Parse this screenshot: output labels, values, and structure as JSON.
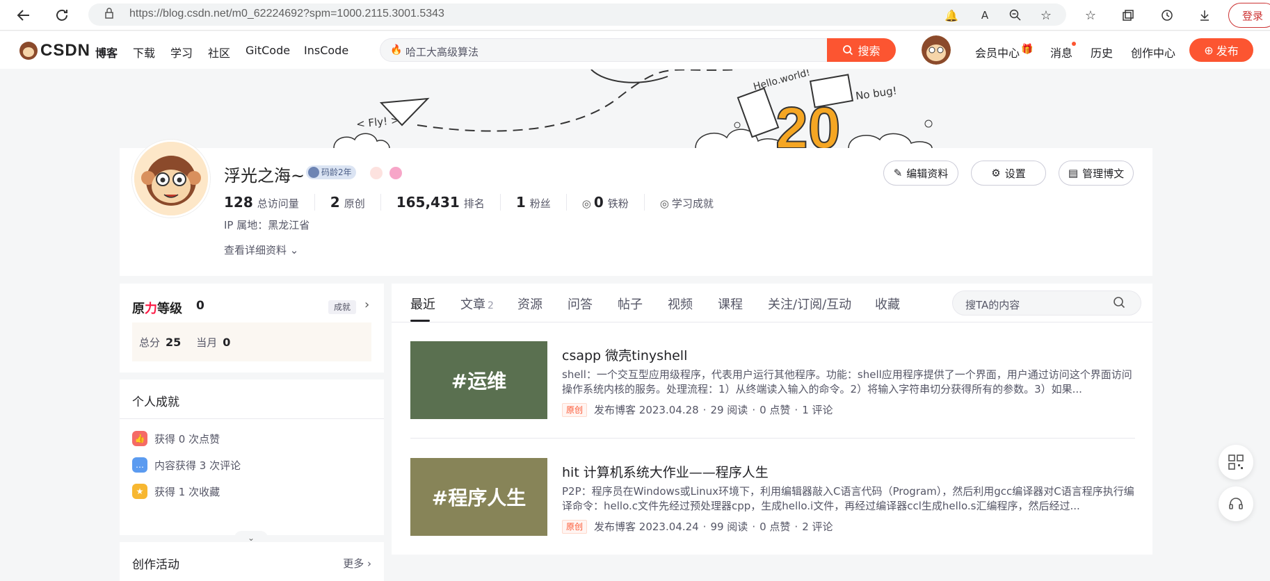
{
  "browser": {
    "url": "https://blog.csdn.net/m0_62224692?spm=1000.2115.3001.5343",
    "login": "登录"
  },
  "nav": {
    "logo": "CSDN",
    "links": [
      "博客",
      "下载",
      "学习",
      "社区",
      "GitCode",
      "InsCode"
    ],
    "search_placeholder": "哈工大高级算法",
    "search_button": "搜索",
    "right_links": [
      "会员中心",
      "消息",
      "历史",
      "创作中心"
    ],
    "publish": "发布"
  },
  "banner": {
    "fly": "< Fly! >",
    "hello": "Hello.world!",
    "nobug": "No bug!",
    "number": "20"
  },
  "profile": {
    "name": "浮光之海~",
    "age_badge": "码龄2年",
    "stats": [
      {
        "num": "128",
        "label": "总访问量"
      },
      {
        "num": "2",
        "label": "原创"
      },
      {
        "num": "165,431",
        "label": "排名"
      },
      {
        "num": "1",
        "label": "粉丝"
      },
      {
        "num": "0",
        "label": "铁粉"
      },
      {
        "num": "",
        "label": "学习成就"
      }
    ],
    "ip": "IP 属地：黑龙江省",
    "more": "查看详细资料",
    "buttons": [
      "编辑资料",
      "设置",
      "管理博文"
    ]
  },
  "level": {
    "title_a": "原",
    "title_b": "力",
    "title_c": "等级",
    "value": "0",
    "tag": "成就",
    "total_label": "总分",
    "total": "25",
    "month_label": "当月",
    "month": "0"
  },
  "achievements": {
    "title": "个人成就",
    "items": [
      "获得 0 次点赞",
      "内容获得 3 次评论",
      "获得 1 次收藏"
    ]
  },
  "activity": {
    "title": "创作活动",
    "more": "更多"
  },
  "tabs": {
    "items": [
      "最近",
      "文章",
      "资源",
      "问答",
      "帖子",
      "视频",
      "课程",
      "关注/订阅/互动",
      "收藏"
    ],
    "article_count": "2",
    "search_placeholder": "搜TA的内容"
  },
  "articles": [
    {
      "thumb": "#运维",
      "title": "csapp 微壳tinyshell",
      "desc": "shell：一个交互型应用级程序，代表用户运行其他程序。功能：shell应用程序提供了一个界面，用户通过访问这个界面访问操作系统内核的服务。处理流程：1）从终端读入输入的命令。2）将输入字符串切分获得所有的参数。3）如果...",
      "tag": "原创",
      "date": "发布博客 2023.04.28",
      "reads": "29 阅读",
      "likes": "0 点赞",
      "comments": "1 评论"
    },
    {
      "thumb": "#程序人生",
      "title": "hit 计算机系统大作业——程序人生",
      "desc": "P2P：程序员在Windows或Linux环境下，利用编辑器敲入C语言代码（Program），然后利用gcc编译器对C语言程序执行编译命令：hello.c文件先经过预处理器cpp，生成hello.i文件，再经过编译器ccl生成hello.s汇编程序，然后经过...",
      "tag": "原创",
      "date": "发布博客 2023.04.24",
      "reads": "99 阅读",
      "likes": "0 点赞",
      "comments": "2 评论"
    }
  ],
  "colors": {
    "accent": "#fc5531",
    "thumb1": "#5a7050",
    "thumb2": "#878458"
  }
}
